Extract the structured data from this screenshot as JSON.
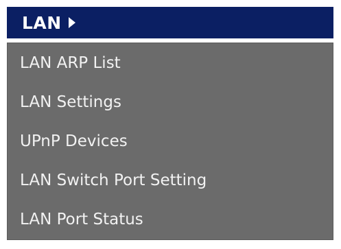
{
  "menu": {
    "header": {
      "label": "LAN",
      "arrow_icon": "triangle-right-icon"
    },
    "items": [
      {
        "label": "LAN ARP List"
      },
      {
        "label": "LAN Settings"
      },
      {
        "label": "UPnP Devices"
      },
      {
        "label": "LAN Switch Port Setting"
      },
      {
        "label": "LAN Port Status"
      }
    ]
  },
  "colors": {
    "header_bg": "#0b1f63",
    "menu_bg": "#6b6b6b",
    "text": "#f2f2f2"
  }
}
